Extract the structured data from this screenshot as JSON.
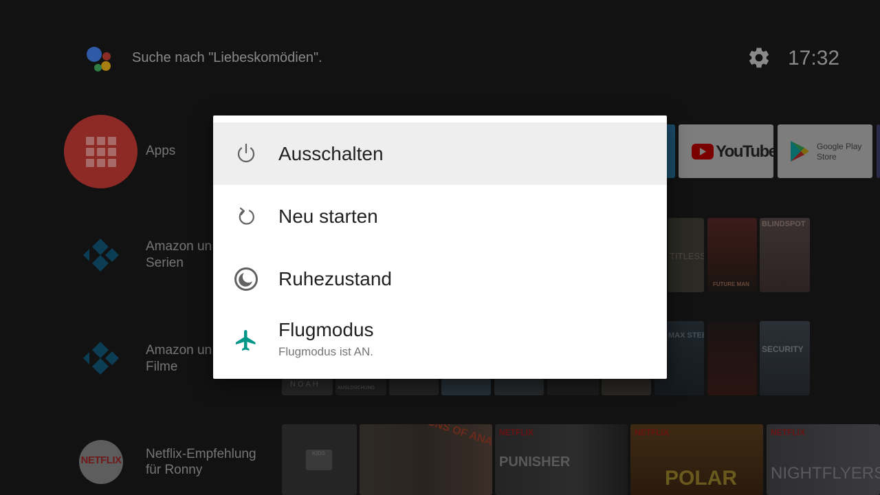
{
  "header": {
    "assistant_icon": "google-assistant-icon",
    "search_hint": "Suche nach \"Liebeskomödien\".",
    "settings_icon": "gear-icon",
    "clock": "17:32"
  },
  "rows": [
    {
      "icon": "apps-grid-icon",
      "label": "Apps"
    },
    {
      "icon": "kodi-icon",
      "label_line1": "Amazon un",
      "label_line2": "Serien"
    },
    {
      "icon": "kodi-icon",
      "label_line1": "Amazon un",
      "label_line2": "Filme"
    },
    {
      "icon": "netflix-icon",
      "icon_text": "NETFLIX",
      "label_line1": "Netflix-Empfehlung",
      "label_line2": "für Ronny"
    }
  ],
  "app_tiles": [
    {
      "name": "YouTube",
      "text": "YouTube"
    },
    {
      "name": "Google Play Store",
      "line1": "Google Play",
      "line2": "Store"
    }
  ],
  "posters_row1": [
    "TITLESS",
    "FUTURE MAN",
    "BLINDSPOT"
  ],
  "posters_row2": [
    "NOAH",
    "AUSLÖSCHUNG",
    "MAX STEEL",
    "SECURITY"
  ],
  "posters_row3": [
    "KIDS",
    "SONS OF ANARCHY",
    "NETFLIX",
    "PUNISHER",
    "NETFLIX",
    "POLAR",
    "NETFLIX",
    "NIGHTFLYERS"
  ],
  "dialog": {
    "items": [
      {
        "icon": "power-icon",
        "label": "Ausschalten",
        "focused": true
      },
      {
        "icon": "restart-icon",
        "label": "Neu starten"
      },
      {
        "icon": "sleep-moon-icon",
        "label": "Ruhezustand"
      },
      {
        "icon": "airplane-icon",
        "label": "Flugmodus",
        "sublabel": "Flugmodus ist AN."
      }
    ]
  },
  "colors": {
    "airplane_icon": "#009688",
    "apps_circle": "#8e2a26",
    "kodi_blue": "#17a9d6",
    "youtube_red": "#ff0000"
  }
}
